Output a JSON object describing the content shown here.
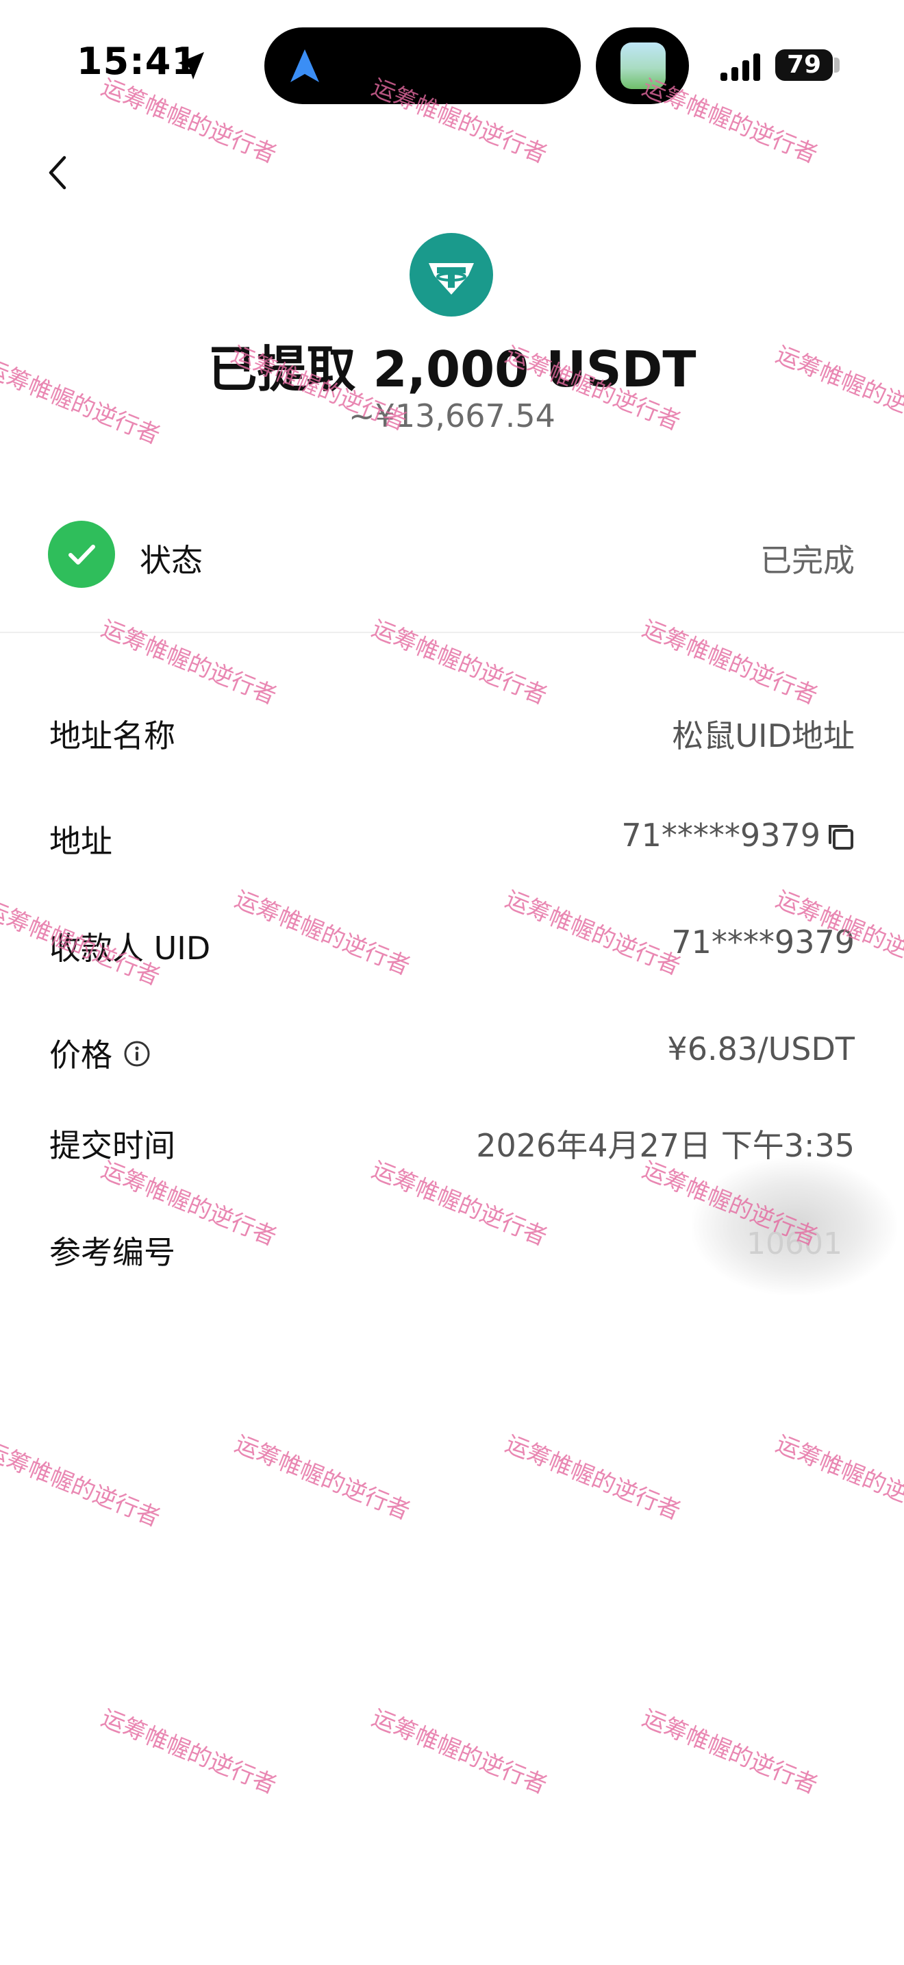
{
  "status_bar": {
    "time": "15:41",
    "battery": "79"
  },
  "header": {
    "title": "已提取 2,000 USDT",
    "subtitle": "~¥13,667.54"
  },
  "status": {
    "label": "状态",
    "value": "已完成"
  },
  "details": {
    "address_name": {
      "label": "地址名称",
      "value": "松鼠UID地址"
    },
    "address": {
      "label": "地址",
      "value": "71*****9379"
    },
    "payee_uid": {
      "label": "收款人 UID",
      "value": "71****9379"
    },
    "price": {
      "label": "价格",
      "value": "¥6.83/USDT"
    },
    "submit_time": {
      "label": "提交时间",
      "value": "2026年4月27日 下午3:35"
    },
    "reference_no": {
      "label": "参考编号",
      "value": "10601"
    }
  },
  "watermark_text": "运筹帷幄的逆行者",
  "colors": {
    "accent_green": "#2fbe5b",
    "usdt_teal": "#1a9a8c",
    "watermark_pink": "#e46aa0"
  },
  "icons": [
    "location-arrow-icon",
    "navigation-arrow-icon",
    "signal-icon",
    "battery-icon",
    "back-chevron-icon",
    "usdt-coin-icon",
    "check-icon",
    "copy-icon",
    "info-icon"
  ]
}
